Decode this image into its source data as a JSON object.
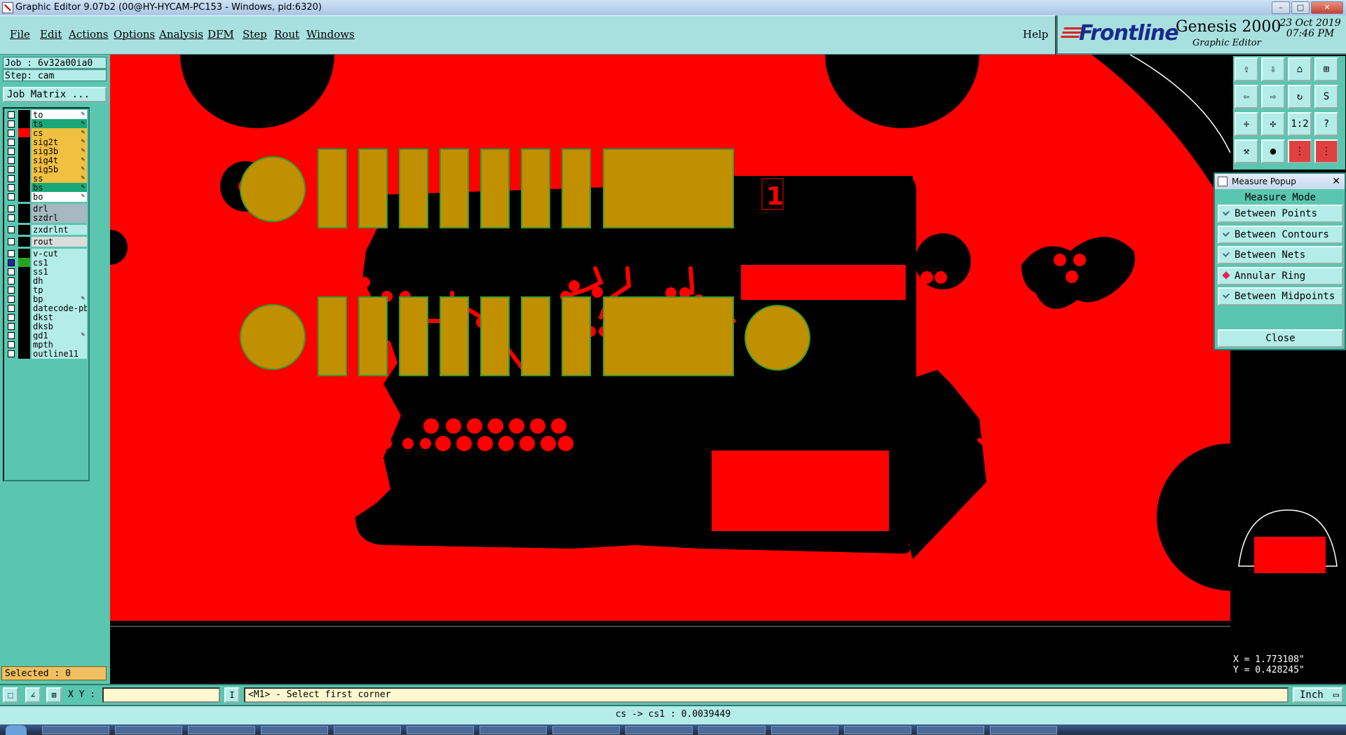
{
  "window": {
    "title": "Graphic Editor 9.07b2 (00@HY-HYCAM-PC153 - Windows, pid:6320)",
    "controls": [
      "–",
      "□",
      "✕"
    ]
  },
  "menu": [
    "File",
    "Edit",
    "Actions",
    "Options",
    "Analysis",
    "DFM",
    "Step",
    "Rout",
    "Windows"
  ],
  "help": "Help",
  "brand": {
    "logo": "Frontline",
    "product": "Genesis 2000",
    "subtitle": "Graphic Editor",
    "date": "23 Oct 2019",
    "time": "07:46 PM"
  },
  "job": {
    "job_line": "Job : 6v32a00ia0",
    "step_line": "Step: cam",
    "matrix_button": "Job Matrix ..."
  },
  "layers": [
    {
      "name": "to",
      "bg": "#ffffff",
      "color": "#000000",
      "editable": true
    },
    {
      "name": "ts",
      "bg": "#1aa878",
      "color": "#000000",
      "editable": true
    },
    {
      "name": "cs",
      "bg": "#f0c040",
      "color": "#ff0000",
      "editable": true
    },
    {
      "name": "sig2t",
      "bg": "#f0c040",
      "color": "#000000",
      "editable": true
    },
    {
      "name": "sig3b",
      "bg": "#f0c040",
      "color": "#000000",
      "editable": true
    },
    {
      "name": "sig4t",
      "bg": "#f0c040",
      "color": "#000000",
      "editable": true
    },
    {
      "name": "sig5b",
      "bg": "#f0c040",
      "color": "#000000",
      "editable": true
    },
    {
      "name": "ss",
      "bg": "#f0c040",
      "color": "#000000",
      "editable": true
    },
    {
      "name": "bs",
      "bg": "#1aa878",
      "color": "#000000",
      "editable": true
    },
    {
      "name": "bo",
      "bg": "#ffffff",
      "color": "#000000",
      "editable": true
    },
    {
      "name": "drl",
      "bg": "#a8b8c0",
      "color": "#000000",
      "editable": false
    },
    {
      "name": "szdrl",
      "bg": "#a8b8c0",
      "color": "#000000",
      "editable": false
    },
    {
      "name": "zxdrlnt",
      "bg": "#b4ece8",
      "color": "#000000",
      "editable": false
    },
    {
      "name": "rout",
      "bg": "#dcdcdc",
      "color": "#000000",
      "editable": false
    },
    {
      "name": "v-cut",
      "bg": "#b4ece8",
      "color": "#000000",
      "editable": false
    },
    {
      "name": "cs1",
      "bg": "#b4ece8",
      "color": "#2aa020",
      "editable": false,
      "active": true
    },
    {
      "name": "ss1",
      "bg": "#b4ece8",
      "color": "#000000",
      "editable": false
    },
    {
      "name": "dh",
      "bg": "#b4ece8",
      "color": "#000000",
      "editable": false
    },
    {
      "name": "tp",
      "bg": "#b4ece8",
      "color": "#000000",
      "editable": false
    },
    {
      "name": "bp",
      "bg": "#b4ece8",
      "color": "#000000",
      "editable": true
    },
    {
      "name": "datecode-pb",
      "bg": "#b4ece8",
      "color": "#000000",
      "editable": false
    },
    {
      "name": "dkst",
      "bg": "#b4ece8",
      "color": "#000000",
      "editable": false
    },
    {
      "name": "dksb",
      "bg": "#b4ece8",
      "color": "#000000",
      "editable": false
    },
    {
      "name": "gd1",
      "bg": "#b4ece8",
      "color": "#000000",
      "editable": true
    },
    {
      "name": "mpth",
      "bg": "#b4ece8",
      "color": "#000000",
      "editable": false
    },
    {
      "name": "outline11",
      "bg": "#b4ece8",
      "color": "#000000",
      "editable": false
    }
  ],
  "selected": "Selected : 0",
  "measure_popup": {
    "title": "Measure Popup",
    "mode_label": "Measure Mode",
    "options": [
      {
        "label": "Between Points",
        "selected": false
      },
      {
        "label": "Between Contours",
        "selected": false
      },
      {
        "label": "Between Nets",
        "selected": false
      },
      {
        "label": "Annular Ring",
        "selected": true
      },
      {
        "label": "Between Midpoints",
        "selected": false
      }
    ],
    "close": "Close"
  },
  "coords": {
    "x": "X = 1.773108\"",
    "y": "Y = 0.428245\""
  },
  "command": {
    "xy_label": "X Y :",
    "xy_value": "",
    "prompt": "<M1> - Select first corner",
    "unit": "Inch"
  },
  "status": "cs -> cs1 : 0.0039449",
  "colors": {
    "copper": "#ff0000",
    "pads": "#c09000",
    "pad_outline": "#3a9a30",
    "panel": "#5ac6b0",
    "button": "#b4ece8"
  }
}
